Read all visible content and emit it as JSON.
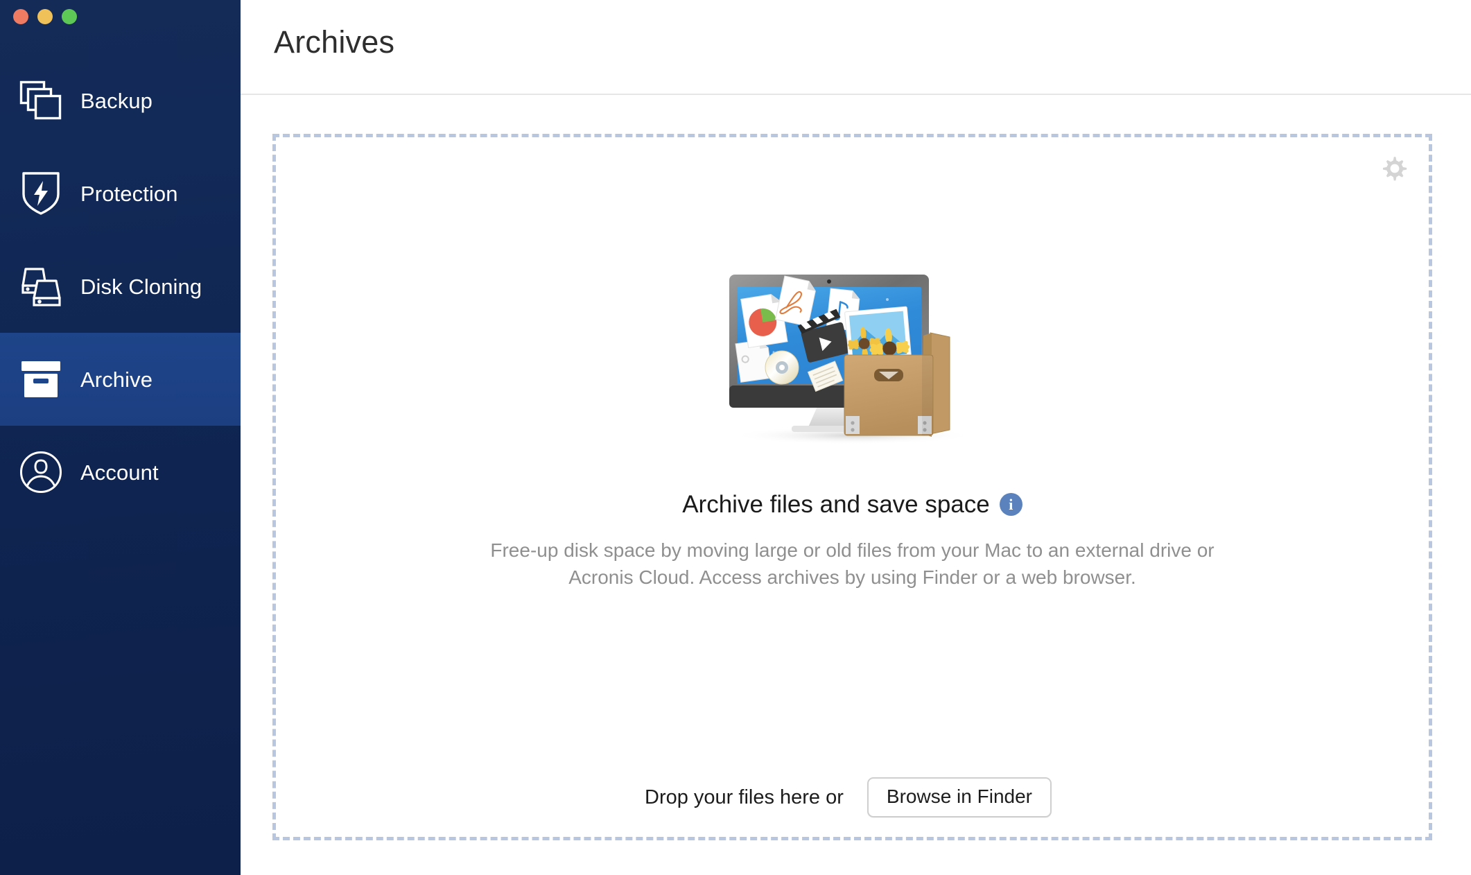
{
  "window": {
    "traffic_lights": [
      {
        "name": "close",
        "color": "#ee7b62"
      },
      {
        "name": "minimize",
        "color": "#efc158"
      },
      {
        "name": "maximize",
        "color": "#5dc856"
      }
    ]
  },
  "sidebar": {
    "background_color": "#0f2450",
    "active_color": "#1e4489",
    "items": [
      {
        "label": "Backup",
        "icon": "stacked-squares-icon",
        "active": false
      },
      {
        "label": "Protection",
        "icon": "shield-bolt-icon",
        "active": false
      },
      {
        "label": "Disk Cloning",
        "icon": "disk-drives-icon",
        "active": false
      },
      {
        "label": "Archive",
        "icon": "archive-box-icon",
        "active": true
      },
      {
        "label": "Account",
        "icon": "user-circle-icon",
        "active": false
      }
    ]
  },
  "header": {
    "title": "Archives"
  },
  "content": {
    "settings_icon": "gear-icon",
    "illustration": "imac-with-files-and-archive-box",
    "headline": "Archive files and save space",
    "info_badge": "i",
    "info_badge_color": "#5b82bd",
    "description": "Free-up disk space by moving large or old files from your Mac to an external drive or Acronis Cloud. Access archives by using Finder or a web browser.",
    "dropzone_border_color": "#b9c6e0",
    "drop_text": "Drop your files here or",
    "browse_button_label": "Browse in Finder"
  }
}
